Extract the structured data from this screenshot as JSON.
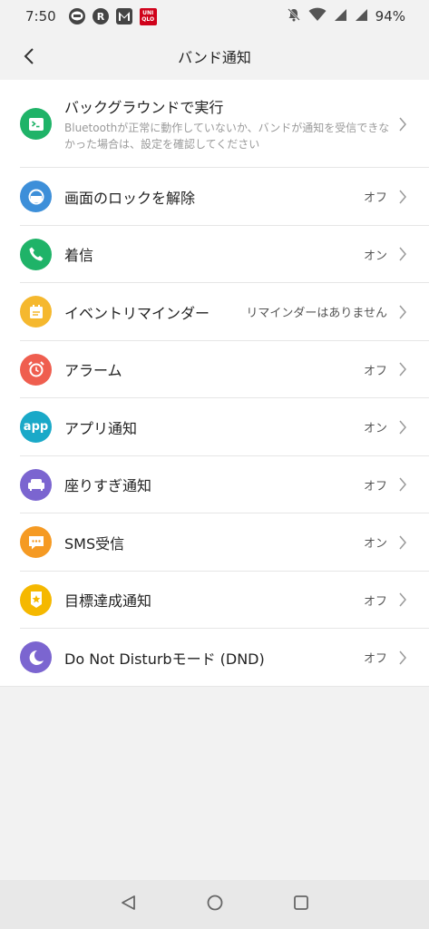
{
  "status_bar": {
    "time": "7:50",
    "battery": "94%",
    "app_icons": [
      "line-icon",
      "r-app-icon",
      "gmail-icon",
      "uniqlo-icon"
    ],
    "uniqlo_text": [
      "UNI",
      "QLO"
    ]
  },
  "header": {
    "title": "バンド通知"
  },
  "items": [
    {
      "label": "バックグラウンドで実行",
      "sub": "Bluetoothが正常に動作していないか、バンドが通知を受信できなかった場合は、設定を確認してください",
      "value": "",
      "icon": "terminal-icon",
      "color": "#1fb368"
    },
    {
      "label": "画面のロックを解除",
      "value": "オフ",
      "icon": "unlock-icon",
      "color": "#3d8fd9"
    },
    {
      "label": "着信",
      "value": "オン",
      "icon": "phone-icon",
      "color": "#1fb368"
    },
    {
      "label": "イベントリマインダー",
      "value": "リマインダーはありません",
      "icon": "calendar-icon",
      "color": "#f5b82e"
    },
    {
      "label": "アラーム",
      "value": "オフ",
      "icon": "alarm-icon",
      "color": "#ef5e4f"
    },
    {
      "label": "アプリ通知",
      "value": "オン",
      "icon": "app-icon",
      "color": "#1aa9c8",
      "icon_text": "app"
    },
    {
      "label": "座りすぎ通知",
      "value": "オフ",
      "icon": "sofa-icon",
      "color": "#7b65d0"
    },
    {
      "label": "SMS受信",
      "value": "オン",
      "icon": "message-icon",
      "color": "#f59a23"
    },
    {
      "label": "目標達成通知",
      "value": "オフ",
      "icon": "medal-icon",
      "color": "#f5b800"
    },
    {
      "label": "Do Not Disturbモード (DND)",
      "value": "オフ",
      "icon": "moon-icon",
      "color": "#7b65d0"
    }
  ]
}
